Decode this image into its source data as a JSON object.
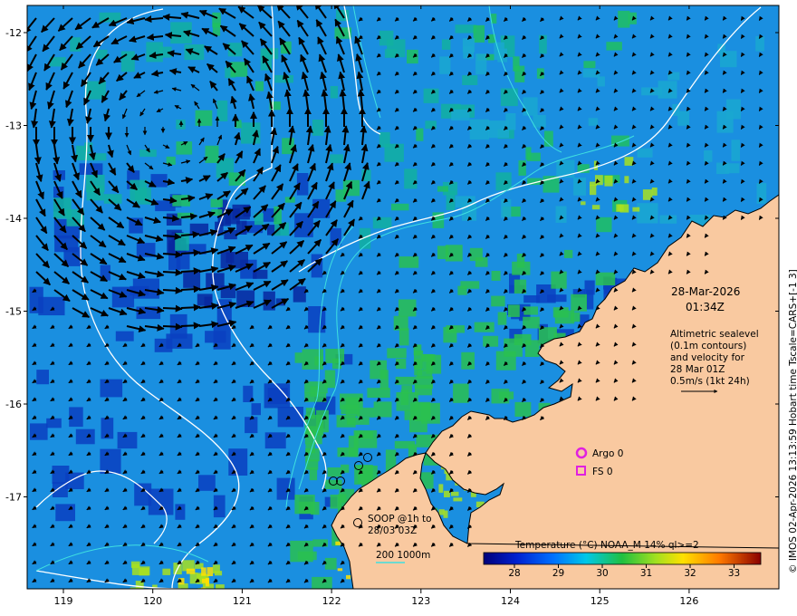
{
  "map": {
    "lon_ticks": [
      "119",
      "120",
      "121",
      "122",
      "123",
      "124",
      "125",
      "126"
    ],
    "lat_ticks": [
      "-12",
      "-13",
      "-14",
      "-15",
      "-16",
      "-17"
    ],
    "date": "28-Mar-2026",
    "time": "01:34Z",
    "altimetry_note": [
      "Altimetric sealevel",
      "(0.1m contours)",
      "and velocity for",
      "28 Mar 01Z",
      "0.5m/s (1kt 24h)"
    ],
    "argo_label": "Argo 0",
    "fs_label": "FS 0",
    "soop_label": [
      "SOOP @1h to",
      "28/03 03Z"
    ],
    "depth_label": "200  1000m",
    "colorbar_title": "Temperature (°C) NOAA_M 14% ql>=2",
    "colorbar_ticks": [
      "28",
      "29",
      "30",
      "31",
      "32",
      "33"
    ],
    "credit": "© IMOS 02-Apr-2026 13:13:59 Hobart time Tscale=CARS+[-1 3]",
    "colors": {
      "land": "#f9c9a0",
      "sea_base": "#1a8fe0",
      "argo_marker": "#e020e0",
      "contour": "#ffffff",
      "isobath": "#3fe0e0"
    }
  }
}
